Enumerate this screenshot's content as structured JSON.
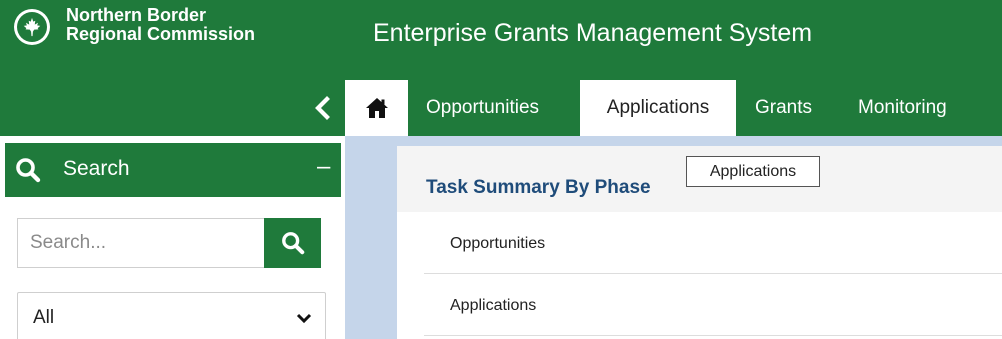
{
  "header": {
    "org_line1": "Northern Border",
    "org_line2": "Regional Commission",
    "app_title": "Enterprise Grants Management System",
    "logo_icon": "maple-leaf-logo"
  },
  "nav": {
    "collapse_icon": "chevron-left-icon",
    "home_icon": "home-icon",
    "tabs": [
      {
        "label": "Opportunities",
        "active": false
      },
      {
        "label": "Applications",
        "active": true
      },
      {
        "label": "Grants",
        "active": false
      },
      {
        "label": "Monitoring",
        "active": false
      }
    ]
  },
  "sidebar": {
    "search_title": "Search",
    "collapse_symbol": "–",
    "search_placeholder": "Search...",
    "filter_value": "All"
  },
  "main": {
    "card_title": "Task Summary By Phase",
    "phases": [
      {
        "label": "Opportunities"
      },
      {
        "label": "Applications"
      }
    ]
  },
  "tooltip": {
    "text": "Applications"
  },
  "colors": {
    "brand_green": "#1f7a3b",
    "panel_blue": "#c5d5ea",
    "title_blue": "#1f4c7a"
  }
}
